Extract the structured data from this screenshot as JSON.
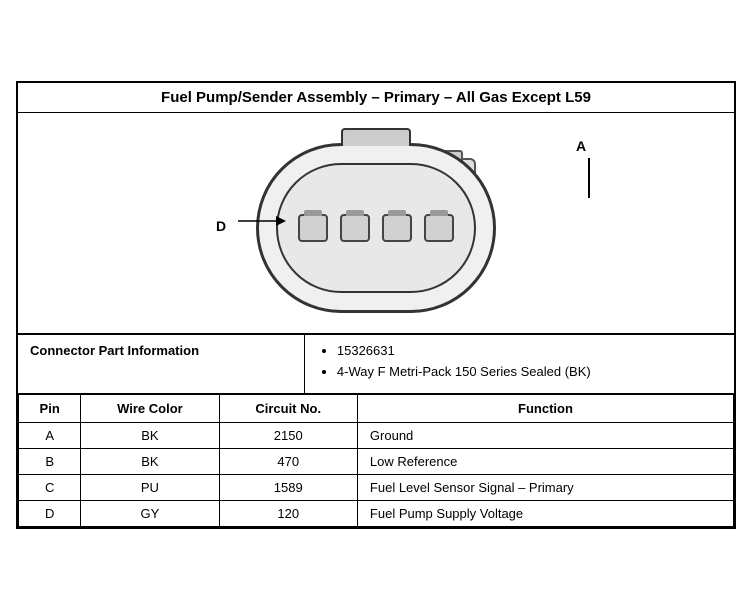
{
  "title": "Fuel Pump/Sender Assembly – Primary – All Gas Except L59",
  "diagram": {
    "label_d": "D",
    "label_a": "A"
  },
  "connector_info": {
    "left_label": "Connector Part Information",
    "bullets": [
      "15326631",
      "4-Way F Metri-Pack 150 Series Sealed (BK)"
    ]
  },
  "table": {
    "headers": [
      "Pin",
      "Wire Color",
      "Circuit No.",
      "Function"
    ],
    "rows": [
      {
        "pin": "A",
        "wire_color": "BK",
        "circuit_no": "2150",
        "function": "Ground"
      },
      {
        "pin": "B",
        "wire_color": "BK",
        "circuit_no": "470",
        "function": "Low Reference"
      },
      {
        "pin": "C",
        "wire_color": "PU",
        "circuit_no": "1589",
        "function": "Fuel Level Sensor Signal – Primary"
      },
      {
        "pin": "D",
        "wire_color": "GY",
        "circuit_no": "120",
        "function": "Fuel Pump Supply Voltage"
      }
    ]
  }
}
